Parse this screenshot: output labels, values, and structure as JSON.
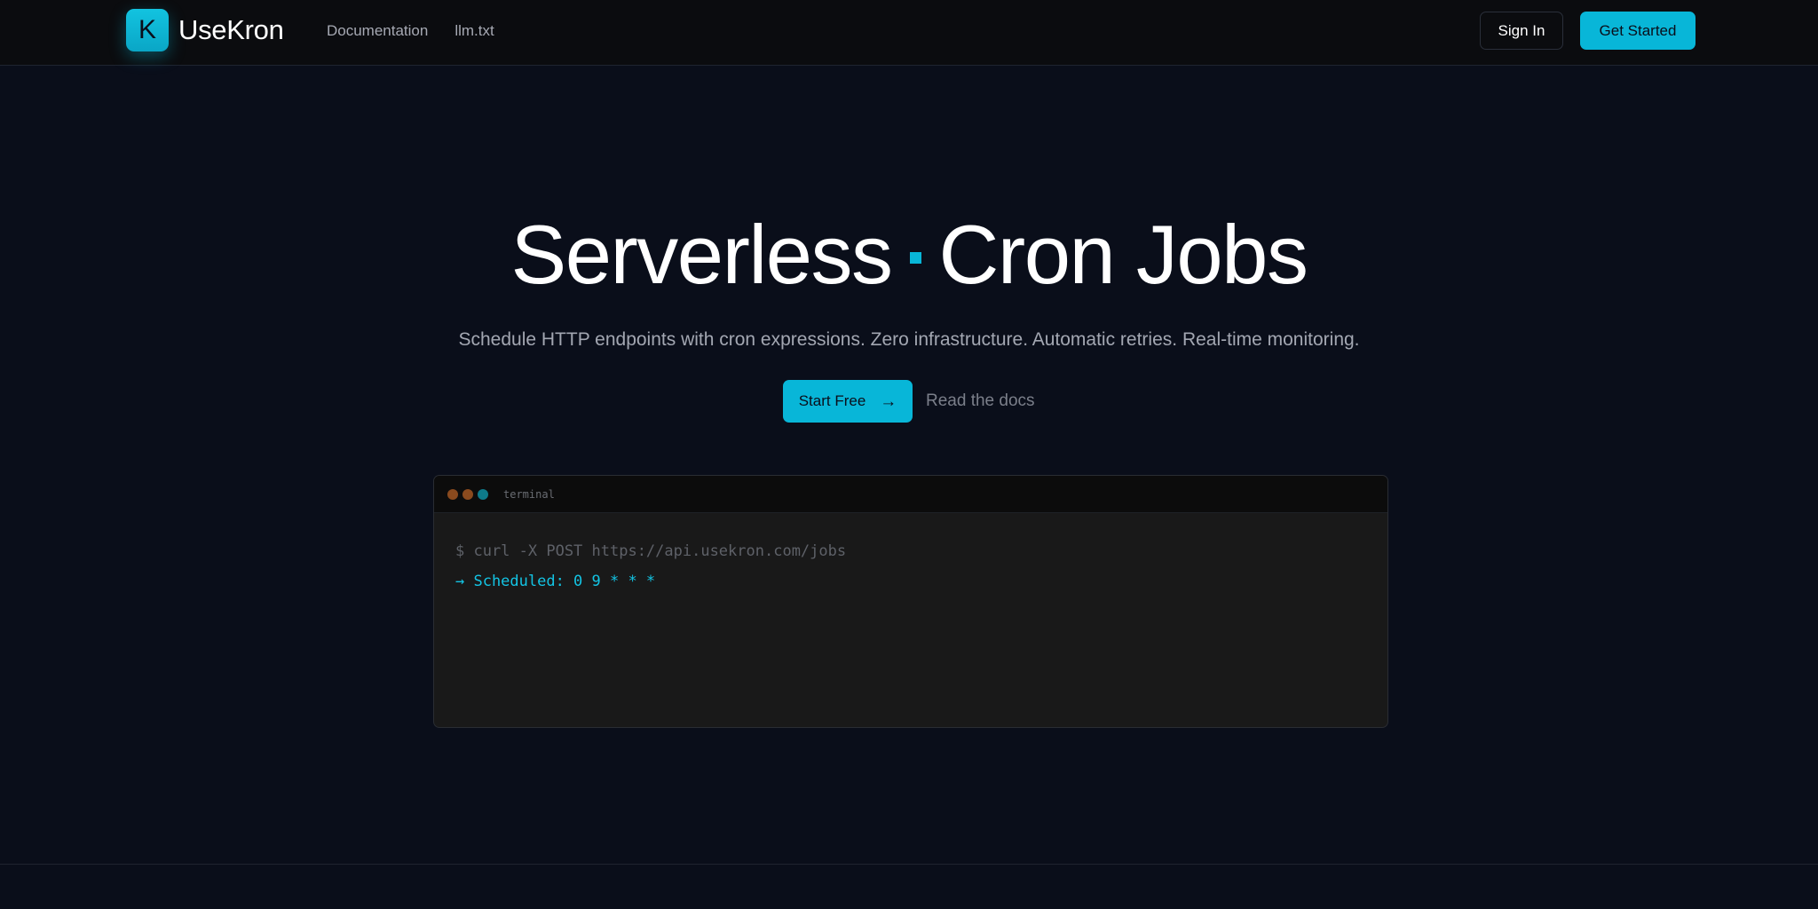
{
  "brand": {
    "logo_letter": "K",
    "name": "UseKron",
    "accent_color": "#08b6d8"
  },
  "nav": {
    "links": [
      "Documentation",
      "llm.txt"
    ],
    "sign_in_label": "Sign In",
    "get_started_label": "Get Started"
  },
  "hero": {
    "title_part1": "Serverless",
    "title_part2": "Cron Jobs",
    "subtitle": "Schedule HTTP endpoints with cron expressions. Zero infrastructure. Automatic retries. Real-time monitoring.",
    "primary_cta": "Start Free",
    "primary_cta_icon": "arrow-right-icon",
    "secondary_cta": "Read the docs"
  },
  "terminal": {
    "title": "terminal",
    "dot_colors": [
      "#8a4a1e",
      "#8a4a1e",
      "#0e7a8a"
    ],
    "command": "$ curl -X POST https://api.usekron.com/jobs",
    "output": "→ Scheduled: 0 9 * * *"
  }
}
